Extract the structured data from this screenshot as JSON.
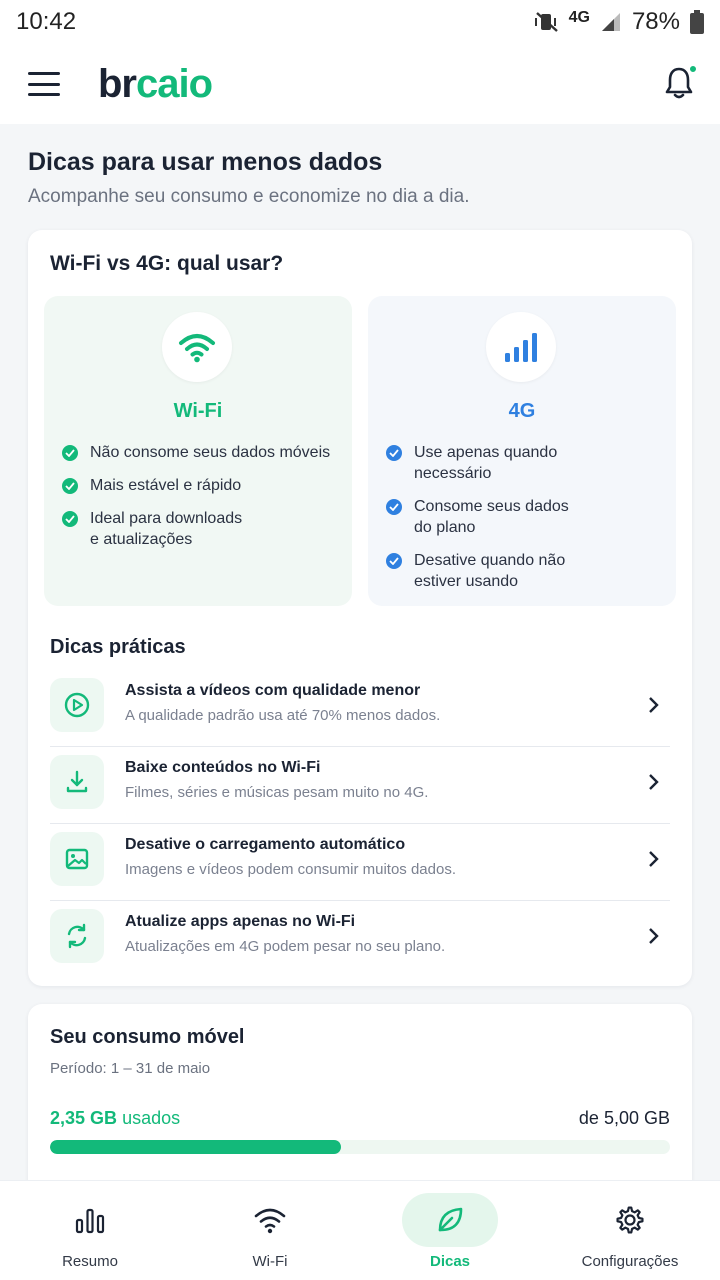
{
  "status": {
    "time": "10:42",
    "network": "4G",
    "battery": "78%"
  },
  "header": {
    "brand_part1": "br",
    "brand_part2": "caio"
  },
  "page": {
    "title": "Dicas para usar menos dados",
    "subtitle": "Acompanhe seu consumo e economize no dia a dia."
  },
  "compare": {
    "title": "Wi-Fi vs 4G: qual usar?",
    "wifi": {
      "label": "Wi-Fi",
      "points": [
        "Não consome seus dados móveis",
        "Mais estável e rápido",
        "Ideal para downloads e atualizações"
      ]
    },
    "lte": {
      "label": "4G",
      "points": [
        "Use apenas quando necessário",
        "Consome seus dados do plano",
        "Desative quando não estiver usando"
      ]
    }
  },
  "tips": {
    "title": "Dicas práticas",
    "items": [
      {
        "title": "Assista a vídeos com qualidade menor",
        "desc": "A qualidade padrão usa até 70% menos dados.",
        "icon": "play-icon"
      },
      {
        "title": "Baixe conteúdos no Wi-Fi",
        "desc": "Filmes, séries e músicas pesam muito no 4G.",
        "icon": "download-icon"
      },
      {
        "title": "Desative o carregamento automático",
        "desc": "Imagens e vídeos podem consumir muitos dados.",
        "icon": "image-icon"
      },
      {
        "title": "Atualize apps apenas no Wi-Fi",
        "desc": "Atualizações em 4G podem pesar no seu plano.",
        "icon": "refresh-icon"
      }
    ]
  },
  "usage": {
    "title": "Seu consumo móvel",
    "period": "Período: 1 – 31 de maio",
    "used_value": "2,35 GB",
    "used_suffix": "usados",
    "total": "de 5,00 GB",
    "fraction": 0.47
  },
  "nav": [
    {
      "label": "Resumo",
      "icon": "bar-chart-icon"
    },
    {
      "label": "Wi-Fi",
      "icon": "wifi-icon"
    },
    {
      "label": "Dicas",
      "icon": "leaf-icon",
      "active": true
    },
    {
      "label": "Configurações",
      "icon": "gear-icon"
    }
  ],
  "colors": {
    "accent": "#13b97a",
    "blue": "#2f80e0",
    "text": "#1b2333"
  }
}
